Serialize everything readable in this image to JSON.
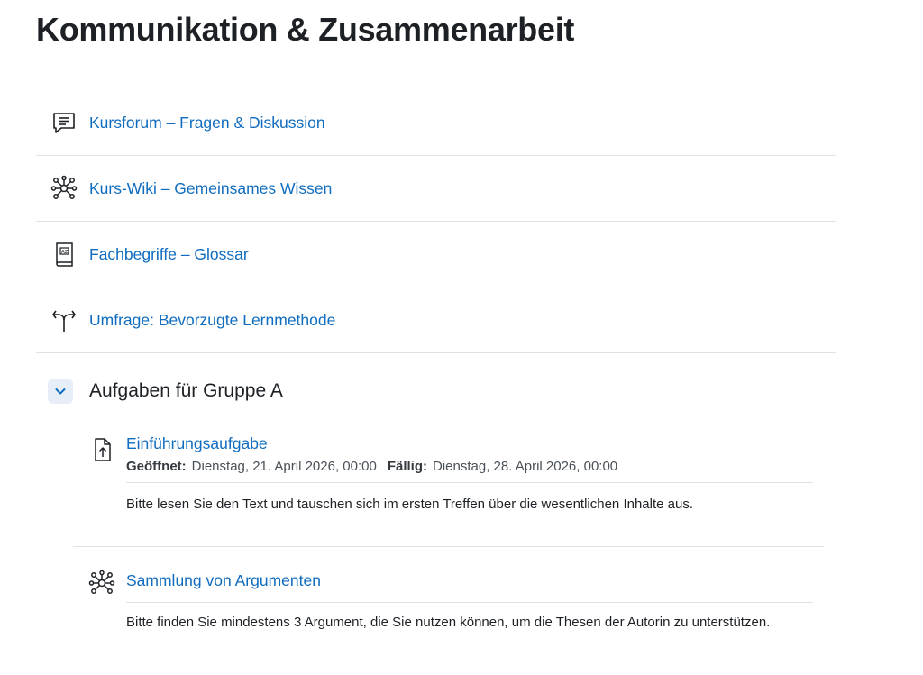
{
  "page": {
    "title": "Kommunikation & Zusammenarbeit"
  },
  "activities": [
    {
      "label": "Kursforum – Fragen & Diskussion",
      "icon": "forum-icon"
    },
    {
      "label": "Kurs-Wiki – Gemeinsames Wissen",
      "icon": "wiki-icon"
    },
    {
      "label": "Fachbegriffe – Glossar",
      "icon": "glossary-icon"
    },
    {
      "label": "Umfrage: Bevorzugte Lernmethode",
      "icon": "choice-icon"
    }
  ],
  "section": {
    "title": "Aufgaben für Gruppe A",
    "toggle_icon": "chevron-down-icon",
    "items": [
      {
        "label": "Einführungsaufgabe",
        "icon": "assignment-upload-icon",
        "opened_label": "Geöffnet:",
        "opened_value": "Dienstag, 21. April 2026, 00:00",
        "due_label": "Fällig:",
        "due_value": "Dienstag, 28. April 2026, 00:00",
        "description": "Bitte lesen Sie den Text und tauschen sich im ersten Treffen über die wesentlichen Inhalte aus."
      },
      {
        "label": "Sammlung von Argumenten",
        "icon": "wiki-icon",
        "description": "Bitte finden Sie mindestens 3 Argument, die Sie nutzen können, um die Thesen der Autorin zu unterstützen."
      }
    ]
  },
  "colors": {
    "link": "#0f6cbf",
    "text": "#1d2125",
    "border": "#dee2e6",
    "toggle_bg": "#e7eef7"
  }
}
